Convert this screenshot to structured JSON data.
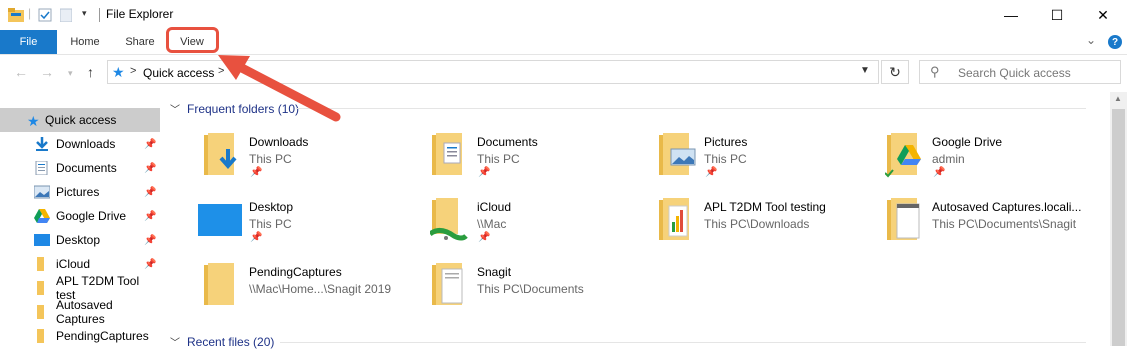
{
  "window": {
    "title": "File Explorer",
    "minimize_symbol": "—",
    "maximize_symbol": "☐",
    "close_symbol": "✕"
  },
  "ribbon": {
    "tabs": [
      "File",
      "Home",
      "Share",
      "View"
    ],
    "help_symbol": "?",
    "collapse_symbol": "⌄"
  },
  "address_bar": {
    "location_icon": "star-icon",
    "path": "Quick access",
    "chevron": ">"
  },
  "search": {
    "placeholder": "Search Quick access"
  },
  "sidebar": {
    "items": [
      {
        "label": "Quick access",
        "icon": "star-icon",
        "pinned": false,
        "selected": true
      },
      {
        "label": "Downloads",
        "icon": "download-icon",
        "pinned": true
      },
      {
        "label": "Documents",
        "icon": "documents-icon",
        "pinned": true
      },
      {
        "label": "Pictures",
        "icon": "pictures-icon",
        "pinned": true
      },
      {
        "label": "Google Drive",
        "icon": "google-drive-icon",
        "pinned": true
      },
      {
        "label": "Desktop",
        "icon": "desktop-icon",
        "pinned": true
      },
      {
        "label": "iCloud",
        "icon": "folder-icon",
        "pinned": true
      },
      {
        "label": "APL T2DM Tool test",
        "icon": "folder-icon",
        "pinned": false
      },
      {
        "label": "Autosaved Captures",
        "icon": "folder-icon",
        "pinned": false
      },
      {
        "label": "PendingCaptures",
        "icon": "folder-icon",
        "pinned": false
      }
    ]
  },
  "main": {
    "frequent_header": "Frequent folders (10)",
    "recent_header": "Recent files (20)",
    "folders": [
      {
        "name": "Downloads",
        "location": "This PC",
        "pinned": true,
        "icon": "downloads-folder-icon"
      },
      {
        "name": "Documents",
        "location": "This PC",
        "pinned": true,
        "icon": "documents-folder-icon"
      },
      {
        "name": "Pictures",
        "location": "This PC",
        "pinned": true,
        "icon": "pictures-folder-icon"
      },
      {
        "name": "Google Drive",
        "location": "admin",
        "pinned": true,
        "icon": "google-drive-folder-icon"
      },
      {
        "name": "Desktop",
        "location": "This PC",
        "pinned": true,
        "icon": "desktop-folder-icon"
      },
      {
        "name": "iCloud",
        "location": "\\\\Mac",
        "pinned": true,
        "icon": "network-folder-icon"
      },
      {
        "name": "APL T2DM Tool testing",
        "location": "This PC\\Downloads",
        "pinned": false,
        "icon": "folder-icon"
      },
      {
        "name": "Autosaved Captures.locali...",
        "location": "This PC\\Documents\\Snagit",
        "pinned": false,
        "icon": "folder-icon"
      },
      {
        "name": "PendingCaptures",
        "location": "\\\\Mac\\Home...\\Snagit 2019",
        "pinned": false,
        "icon": "folder-icon"
      },
      {
        "name": "Snagit",
        "location": "This PC\\Documents",
        "pinned": false,
        "icon": "folder-icon"
      }
    ]
  },
  "annotation": {
    "color": "#e8513f",
    "target": "View"
  },
  "colors": {
    "accent": "#1979ca",
    "group_header": "#1e3287",
    "folder": "#f4c55a"
  }
}
